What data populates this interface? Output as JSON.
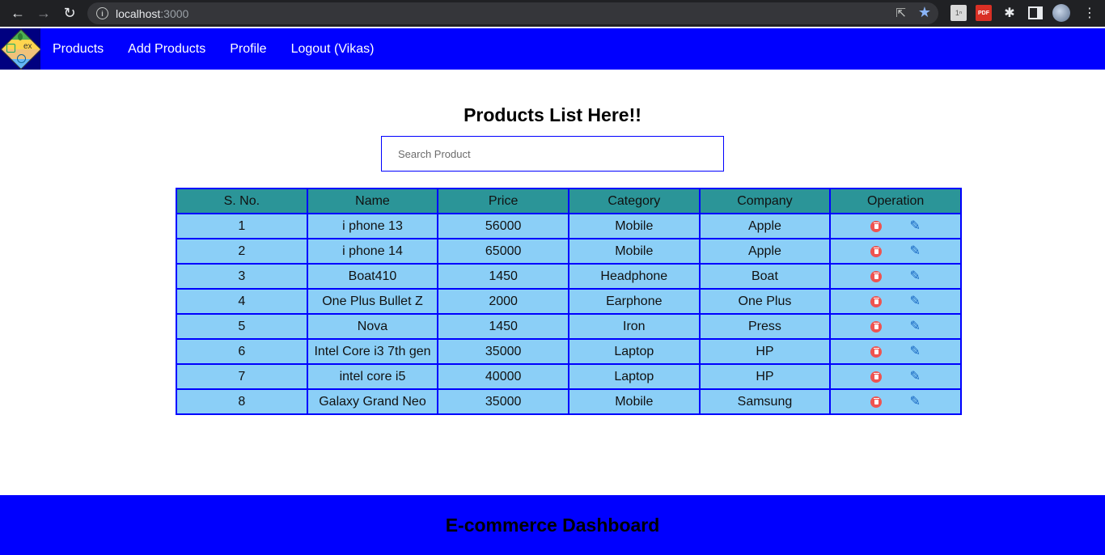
{
  "browser": {
    "url_host": "localhost",
    "url_port": ":3000"
  },
  "nav": {
    "links": [
      "Products",
      "Add Products",
      "Profile",
      "Logout (Vikas)"
    ]
  },
  "main": {
    "title": "Products List Here!!",
    "search_placeholder": "Search Product"
  },
  "table": {
    "headers": [
      "S. No.",
      "Name",
      "Price",
      "Category",
      "Company",
      "Operation"
    ],
    "rows": [
      [
        "1",
        "i phone 13",
        "56000",
        "Mobile",
        "Apple"
      ],
      [
        "2",
        "i phone 14",
        "65000",
        "Mobile",
        "Apple"
      ],
      [
        "3",
        "Boat410",
        "1450",
        "Headphone",
        "Boat"
      ],
      [
        "4",
        "One Plus Bullet Z",
        "2000",
        "Earphone",
        "One Plus"
      ],
      [
        "5",
        "Nova",
        "1450",
        "Iron",
        "Press"
      ],
      [
        "6",
        "Intel Core i3 7th gen",
        "35000",
        "Laptop",
        "HP"
      ],
      [
        "7",
        "intel core i5",
        "40000",
        "Laptop",
        "HP"
      ],
      [
        "8",
        "Galaxy Grand Neo",
        "35000",
        "Mobile",
        "Samsung"
      ]
    ]
  },
  "footer": {
    "title": "E-commerce Dashboard"
  },
  "colors": {
    "nav_bg": "#0000ff",
    "header_bg": "#2b9598",
    "row_bg": "#8bcff7",
    "delete": "#ef5350",
    "edit": "#1565c0"
  }
}
